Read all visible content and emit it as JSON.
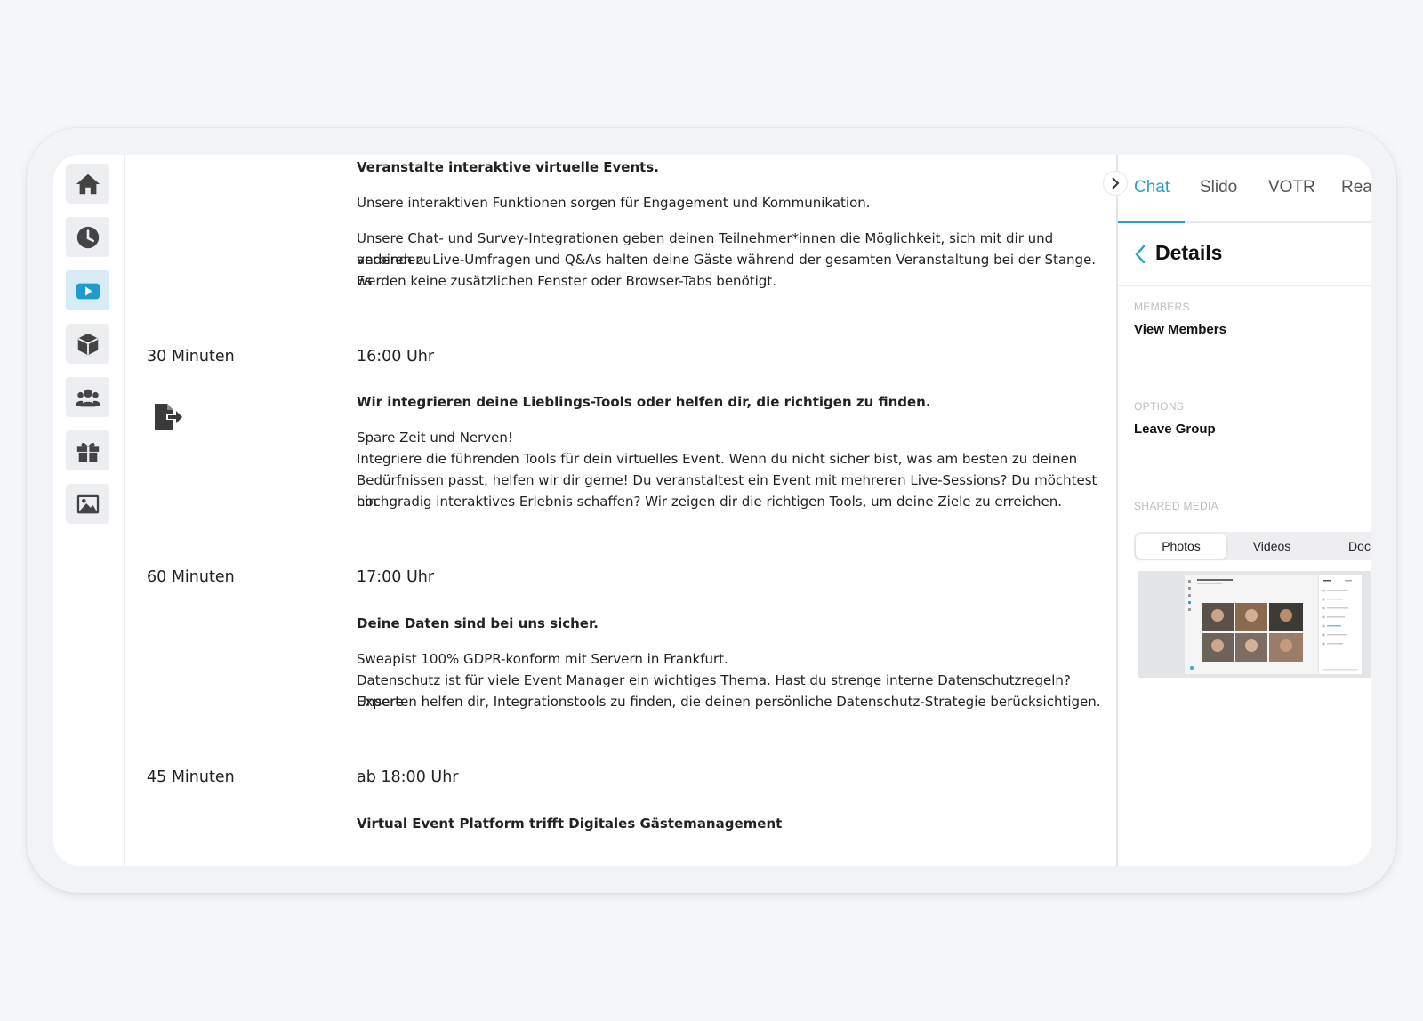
{
  "rail": {
    "items": [
      {
        "icon": "home-icon",
        "active": false
      },
      {
        "icon": "clock-icon",
        "active": false
      },
      {
        "icon": "video-icon",
        "active": true
      },
      {
        "icon": "box-icon",
        "active": false
      },
      {
        "icon": "users-icon",
        "active": false
      },
      {
        "icon": "gift-icon",
        "active": false
      },
      {
        "icon": "image-icon",
        "active": false
      }
    ]
  },
  "agenda": {
    "intro": {
      "heading": "Veranstalte interaktive virtuelle Events.",
      "para1": "Unsere interaktiven Funktionen sorgen für Engagement und Kommunikation.",
      "para2_line1": "Unsere Chat- und Survey-Integrationen geben deinen Teilnehmer*innen die Möglichkeit, sich mit dir und anderen zu",
      "para2_line2": "verbinden. Live-Umfragen und Q&As halten deine Gäste während der gesamten Veranstaltung bei der Stange. Es",
      "para2_line3": "werden keine zusätzlichen Fenster oder Browser-Tabs benötigt."
    },
    "items": [
      {
        "duration": "30 Minuten",
        "time": "16:00 Uhr",
        "heading": "Wir integrieren deine Lieblings-Tools oder helfen dir, die richtigen zu finden.",
        "line1": "Spare Zeit und Nerven!",
        "line2": "Integriere die führenden Tools für dein virtuelles Event. Wenn du nicht sicher bist, was am besten zu deinen",
        "line3": "Bedürfnissen passt, helfen wir dir gerne! Du veranstaltest ein Event mit mehreren Live-Sessions? Du möchtest ein",
        "line4": "hochgradig interaktives Erlebnis schaffen? Wir zeigen dir die richtigen Tools, um deine Ziele zu erreichen."
      },
      {
        "duration": "60 Minuten",
        "time": "17:00 Uhr",
        "heading": "Deine Daten sind bei uns sicher.",
        "line1": "Sweapist 100% GDPR-konform mit Servern in Frankfurt.",
        "line2": "Datenschutz ist für viele Event Manager ein wichtiges Thema. Hast du strenge interne Datenschutzregeln? Unsere",
        "line3": "Experten helfen dir, Integrationstools zu finden, die deinen persönliche Datenschutz-Strategie berücksichtigen."
      },
      {
        "duration": "45 Minuten",
        "time": "ab 18:00 Uhr",
        "heading": "Virtual Event Platform trifft Digitales Gästemanagement"
      }
    ]
  },
  "panel": {
    "tabs": [
      "Chat",
      "Slido",
      "VOTR",
      "Reactions"
    ],
    "active_tab": "Chat",
    "details_title": "Details",
    "members_label": "MEMBERS",
    "members_item": "View Members",
    "options_label": "OPTIONS",
    "options_item": "Leave Group",
    "media_label": "SHARED MEDIA",
    "media_tabs": [
      "Photos",
      "Videos",
      "Docs"
    ],
    "media_active": "Photos",
    "accent": "#2a9fc6"
  }
}
